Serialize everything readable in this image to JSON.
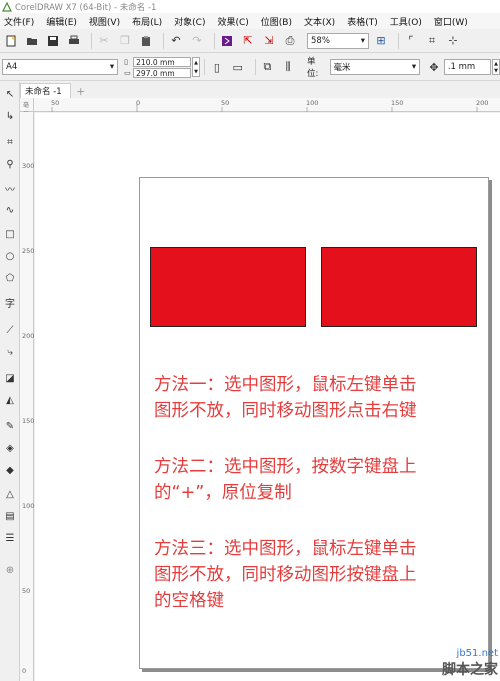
{
  "window": {
    "title": "CorelDRAW X7 (64-Bit) - 未命名 -1"
  },
  "menu": [
    "文件(F)",
    "编辑(E)",
    "视图(V)",
    "布局(L)",
    "对象(C)",
    "效果(C)",
    "位图(B)",
    "文本(X)",
    "表格(T)",
    "工具(O)",
    "窗口(W)"
  ],
  "toolbar": {
    "zoom": "58%"
  },
  "property_bar": {
    "page_size": "A4",
    "width": "210.0 mm",
    "height": "297.0 mm",
    "unit_label": "单位:",
    "unit": "毫米",
    "nudge": ".1 mm"
  },
  "tabs": [
    {
      "label": "未命名 -1"
    }
  ],
  "ruler": {
    "top_labels": [
      "50",
      "0",
      "50",
      "100",
      "150",
      "200"
    ],
    "left_labels": [
      "300",
      "250",
      "200",
      "150",
      "100",
      "50",
      "0"
    ],
    "unit": "毫米"
  },
  "document": {
    "shape_color": "#e4101c",
    "text_color": "#e53c3c",
    "paragraphs": [
      {
        "lines": [
          "方法一：选中图形，鼠标左键单击",
          "图形不放，同时移动图形点击右键"
        ]
      },
      {
        "lines": [
          "方法二：选中图形，按数字键盘上",
          "的“+”，原位复制"
        ]
      },
      {
        "lines": [
          "方法三：选中图形，鼠标左键单击",
          "图形不放，同时移动图形按键盘上",
          "的空格键"
        ]
      }
    ]
  },
  "watermark": {
    "site": "jb51.net",
    "name": "脚本之家"
  }
}
